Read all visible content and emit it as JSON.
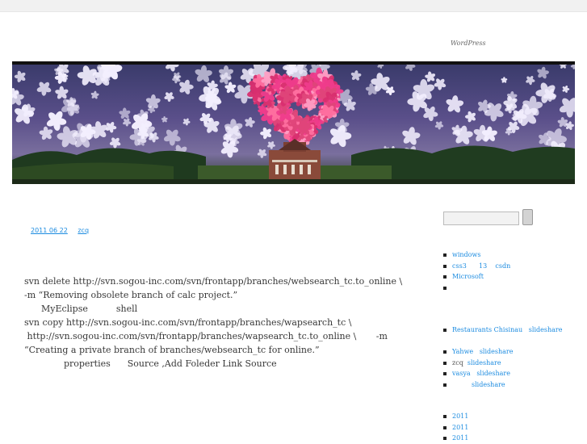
{
  "site": {
    "description": "WordPress"
  },
  "post": {
    "date": "2011  06  22",
    "author": "zcq",
    "lines": [
      "svn delete http://svn.sogou-inc.com/svn/frontapp/branches/websearch_tc.to_online \\",
      "   -m “Removing obsolete branch of calc project.”",
      "",
      "      MyEclipse          shell",
      "",
      "svn copy http://svn.sogou-inc.com/svn/frontapp/branches/wapsearch_tc \\",
      " http://svn.sogou-inc.com/svn/frontapp/branches/wapsearch_tc.to_online \\       -m",
      "“Creating a private branch of branches/websearch_tc for online.”",
      "",
      "              properties      Source ,Add Foleder Link Source"
    ]
  },
  "sidebar": {
    "recent_posts": [
      "",
      "windows",
      "css3      13    csdn",
      "Microsoft",
      ""
    ],
    "recent_links": [
      "Restaurants Chisinau   slideshare"
    ],
    "recent_comments": [
      {
        "author": "Yahwe",
        "text": "slideshare"
      },
      {
        "author": "zcq",
        "text": "slideshare"
      },
      {
        "author": "vasya",
        "text": "slideshare"
      },
      {
        "author": "",
        "text": "slideshare"
      }
    ],
    "archives": [
      "2011",
      "2011",
      "2011"
    ]
  },
  "colors": {
    "link": "#1b8be0",
    "text": "#373737",
    "header_rule": "#111111"
  }
}
